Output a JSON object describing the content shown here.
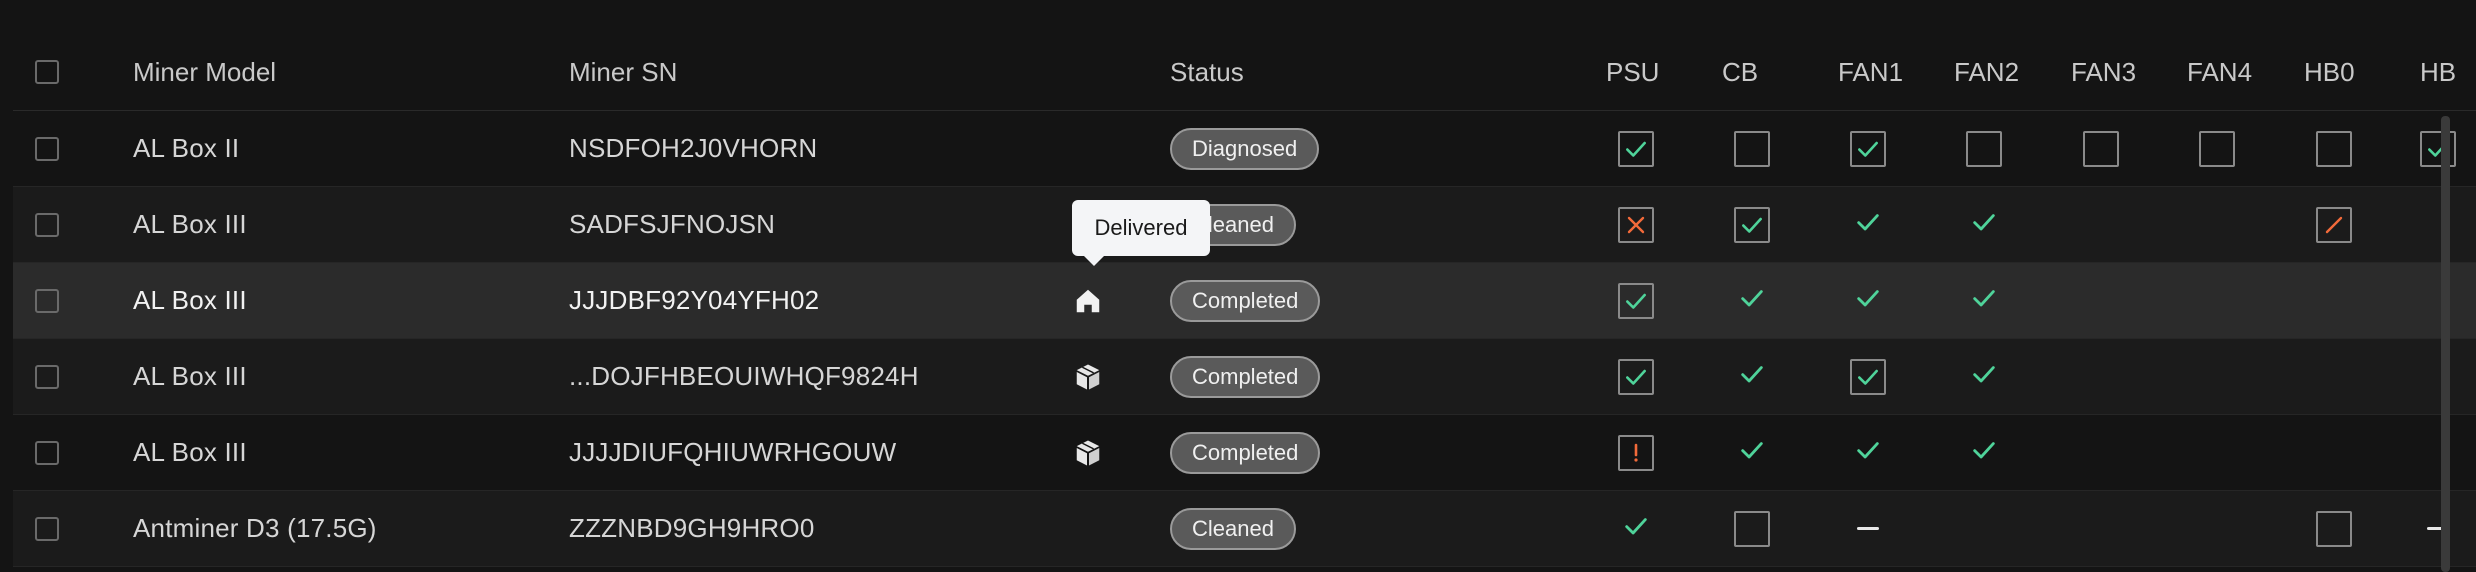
{
  "header": {
    "model": "Miner Model",
    "sn": "Miner SN",
    "status": "Status",
    "psu": "PSU",
    "cb": "CB",
    "fan1": "FAN1",
    "fan2": "FAN2",
    "fan3": "FAN3",
    "fan4": "FAN4",
    "hb0": "HB0",
    "hb1": "HB"
  },
  "tooltip": {
    "text": "Delivered"
  },
  "colors": {
    "check": "#4fd39a",
    "error": "#f26a3a",
    "box": "#8a8a8a"
  },
  "rows": [
    {
      "model": "AL Box II",
      "sn": "NSDFOH2J0VHORN",
      "icon": "",
      "status": "Diagnosed",
      "psu": "box-check",
      "cb": "box",
      "fan1": "box-check",
      "fan2": "box",
      "fan3": "box",
      "fan4": "box",
      "hb0": "box",
      "hb1": "box-check"
    },
    {
      "model": "AL Box III",
      "sn": "SADFSJFNOJSN",
      "icon": "",
      "status": "Cleaned",
      "psu": "box-x",
      "cb": "box-check",
      "fan1": "check",
      "fan2": "check",
      "fan3": "",
      "fan4": "",
      "hb0": "box-slash",
      "hb1": ""
    },
    {
      "model": "AL Box III",
      "sn": "JJJDBF92Y04YFH02",
      "icon": "home-icon",
      "status": "Completed",
      "psu": "box-check",
      "cb": "check",
      "fan1": "check",
      "fan2": "check",
      "fan3": "",
      "fan4": "",
      "hb0": "",
      "hb1": ""
    },
    {
      "model": "AL Box III",
      "sn": "...DOJFHBEOUIWHQF9824H",
      "icon": "package-icon",
      "status": "Completed",
      "psu": "box-check",
      "cb": "check",
      "fan1": "box-check",
      "fan2": "check",
      "fan3": "",
      "fan4": "",
      "hb0": "",
      "hb1": ""
    },
    {
      "model": "AL Box III",
      "sn": "JJJJDIUFQHIUWRHGOUW",
      "icon": "package-icon",
      "status": "Completed",
      "psu": "box-exclaim",
      "cb": "check",
      "fan1": "check",
      "fan2": "check",
      "fan3": "",
      "fan4": "",
      "hb0": "",
      "hb1": ""
    },
    {
      "model": "Antminer D3 (17.5G)",
      "sn": "ZZZNBD9GH9HRO0",
      "icon": "",
      "status": "Cleaned",
      "psu": "check",
      "cb": "box",
      "fan1": "dash",
      "fan2": "",
      "fan3": "",
      "fan4": "",
      "hb0": "box",
      "hb1": "dash"
    }
  ]
}
